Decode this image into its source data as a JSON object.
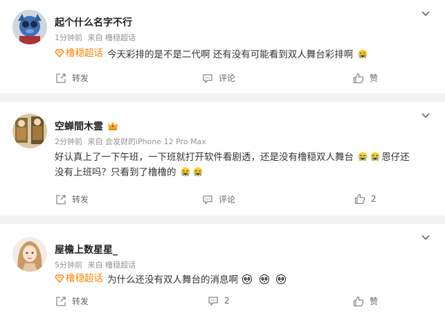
{
  "comments": [
    {
      "name": "起个什么名字不行",
      "time": "1分钟前",
      "source": "来自 橹穏超话",
      "topic": "橹穏超话",
      "text": "今天彩排的是不是二代啊 还有没有可能看到双人舞台彩排啊",
      "emojis": [
        "crying-emoji"
      ],
      "repost_label": "转发",
      "comment_label": "评论",
      "like_label": "赞"
    },
    {
      "name": "空蝉間木霊",
      "badge": "crown-icon",
      "time": "2分钟前",
      "source": "来自 会发财的iPhone 12 Pro Max",
      "text_line1": "好认真上了一下午班，一下班就打开软件看剧透，还是没有橹穏双人舞台",
      "text_line1_tail": "恩仔还",
      "text_line2": "没有上班吗？只看到了橹橹的",
      "repost_label": "转发",
      "comment_label": "评论",
      "like_count": "2"
    },
    {
      "name": "屋檐上数星星_",
      "time": "5分钟前",
      "source": "来自 橹穏超话",
      "topic": "橹穏超话",
      "text": "为什么还没有双人舞台的消息啊",
      "emojis": [
        "panda-emoji",
        "panda-emoji",
        "panda-emoji"
      ],
      "repost_label": "转发",
      "comment_count": "2",
      "like_label": "赞"
    }
  ],
  "colors": {
    "topic": "#ff8200",
    "meta": "#939393",
    "page_bg": "#f2f2f2"
  }
}
